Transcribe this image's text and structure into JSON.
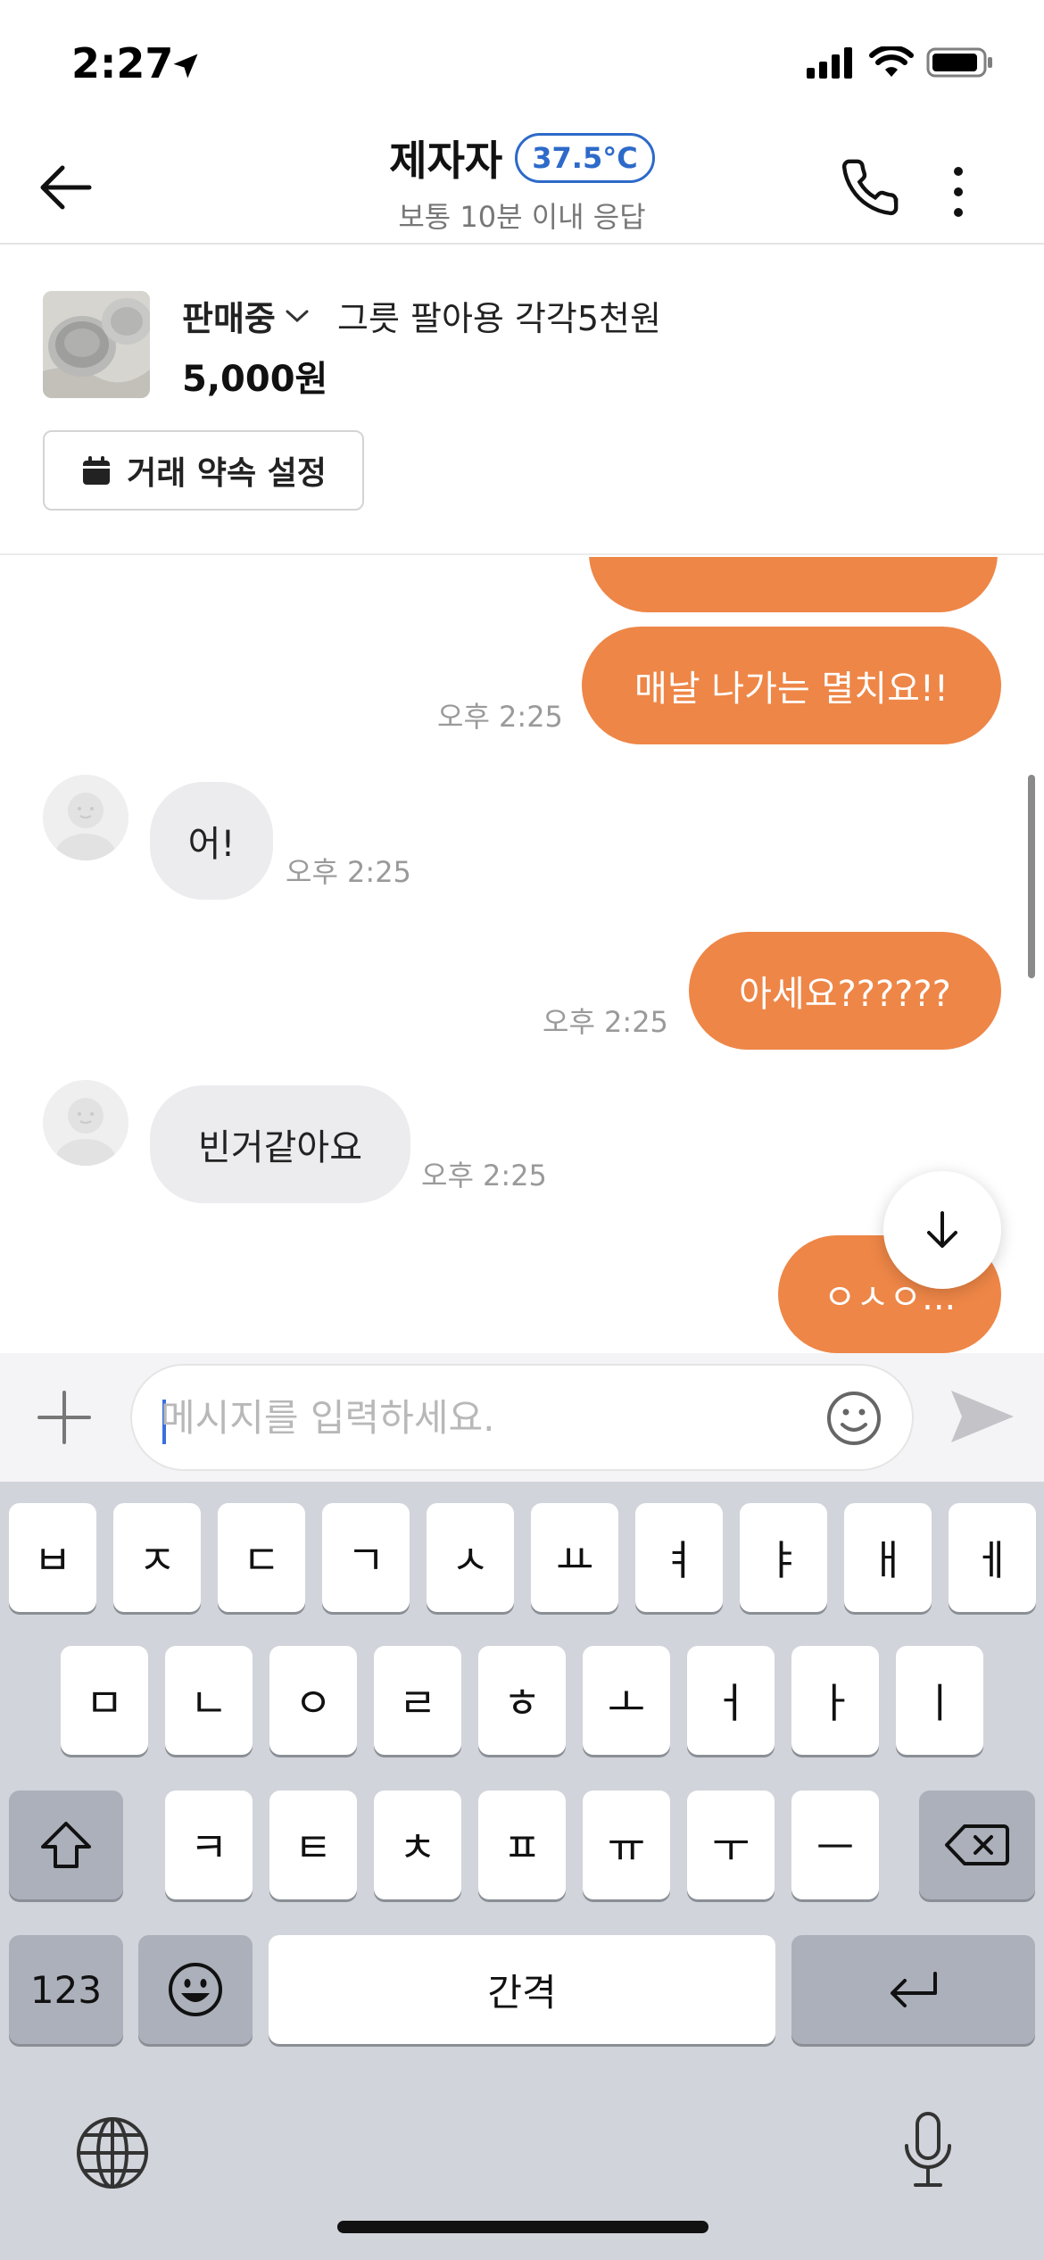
{
  "status_bar": {
    "time": "2:27"
  },
  "header": {
    "name": "제자자",
    "temperature": "37.5°C",
    "response_time": "보통 10분 이내 응답"
  },
  "product": {
    "status": "판매중",
    "title": "그릇 팔아용 각각5천원",
    "price": "5,000원",
    "appointment_button": "거래 약속 설정"
  },
  "messages": [
    {
      "side": "out",
      "text": "매날 나가는 멸치요!!",
      "time": "오후 2:25"
    },
    {
      "side": "in",
      "text": "어!",
      "time": "오후 2:25"
    },
    {
      "side": "out",
      "text": "아세요??????",
      "time": "오후 2:25"
    },
    {
      "side": "in",
      "text": "빈거같아요",
      "time": "오후 2:25"
    },
    {
      "side": "out",
      "text": "ㅇㅅㅇ..."
    }
  ],
  "input": {
    "placeholder": "메시지를 입력하세요."
  },
  "keyboard": {
    "row1": [
      "ㅂ",
      "ㅈ",
      "ㄷ",
      "ㄱ",
      "ㅅ",
      "ㅛ",
      "ㅕ",
      "ㅑ",
      "ㅐ",
      "ㅔ"
    ],
    "row2": [
      "ㅁ",
      "ㄴ",
      "ㅇ",
      "ㄹ",
      "ㅎ",
      "ㅗ",
      "ㅓ",
      "ㅏ",
      "ㅣ"
    ],
    "row3": [
      "ㅋ",
      "ㅌ",
      "ㅊ",
      "ㅍ",
      "ㅠ",
      "ㅜ",
      "ㅡ"
    ],
    "numbers_key": "123",
    "space_key": "간격"
  },
  "colors": {
    "accent": "#ee8647",
    "badge": "#2d6ac9",
    "incoming_bubble": "#ececef"
  },
  "icons": [
    "back-arrow-icon",
    "phone-icon",
    "more-vertical-icon",
    "chevron-down-icon",
    "calendar-icon",
    "plus-icon",
    "smiley-icon",
    "send-icon",
    "arrow-down-icon",
    "shift-icon",
    "backspace-icon",
    "return-icon",
    "emoji-key-icon",
    "globe-icon",
    "microphone-icon"
  ]
}
